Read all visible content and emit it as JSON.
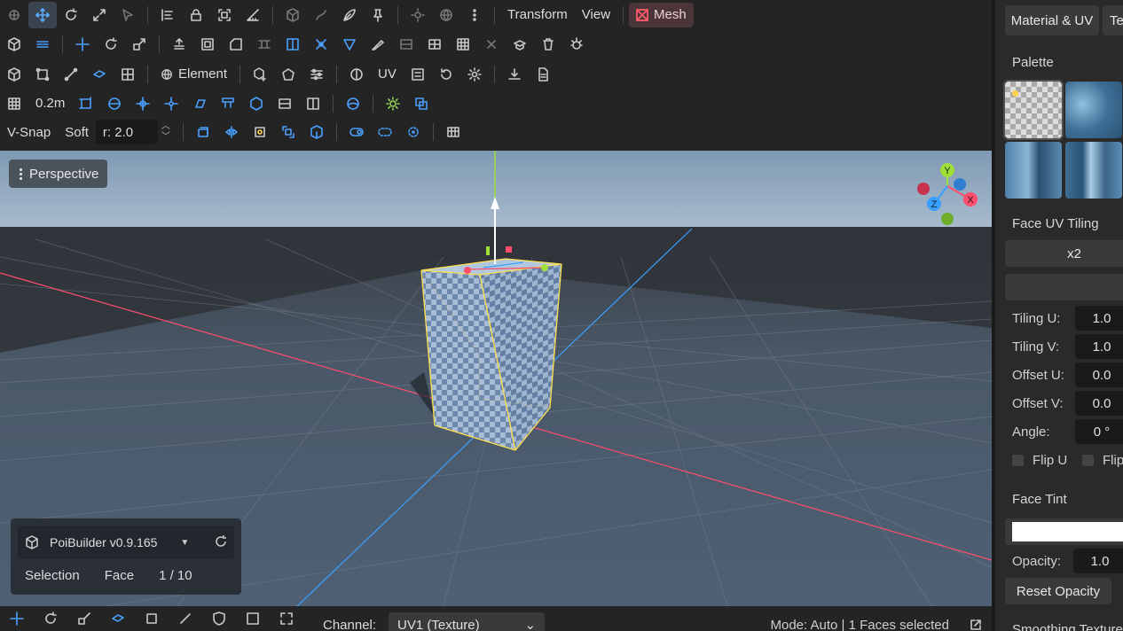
{
  "toolbar": {
    "row1": {
      "transform_label": "Transform",
      "view_label": "View",
      "mesh_label": "Mesh"
    },
    "row3": {
      "element_label": "Element",
      "uv_label": "UV"
    },
    "row4": {
      "grid_size": "0.2m"
    },
    "row5": {
      "vsnap_label": "V-Snap",
      "soft_label": "Soft",
      "radius_value": "r: 2.0"
    }
  },
  "viewport": {
    "camera_button": "Perspective",
    "gizmo": {
      "x": "X",
      "y": "Y",
      "z": "Z"
    },
    "colors": {
      "x_axis": "#ff4d6d",
      "y_axis": "#9fe03a",
      "z_axis": "#3aa0ff",
      "selection": "#ffe14d"
    }
  },
  "info_panel": {
    "version": "PoiBuilder v0.9.165",
    "selection_label": "Selection",
    "mode_value": "Face",
    "count": "1 / 10"
  },
  "statusbar": {
    "channel_label": "Channel:",
    "channel_value": "UV1 (Texture)",
    "status": "Mode: Auto | 1 Faces selected"
  },
  "sidebar": {
    "tabs": [
      "Material & UV",
      "Te"
    ],
    "palette_title": "Palette",
    "face_uv_tiling_title": "Face UV Tiling",
    "tiling_x2": "x2",
    "props": [
      {
        "label": "Tiling U:",
        "value": "1.0"
      },
      {
        "label": "Tiling V:",
        "value": "1.0"
      },
      {
        "label": "Offset U:",
        "value": "0.0"
      },
      {
        "label": "Offset V:",
        "value": "0.0"
      },
      {
        "label": "Angle:",
        "value": "0 °"
      }
    ],
    "flip_u": "Flip U",
    "flip_v": "Flip",
    "face_tint_title": "Face Tint",
    "tint_color": "#ffffff",
    "opacity_label": "Opacity:",
    "opacity_value": "1.0",
    "reset_opacity": "Reset Opacity",
    "bottom_cut": "Smoothing Texture"
  }
}
